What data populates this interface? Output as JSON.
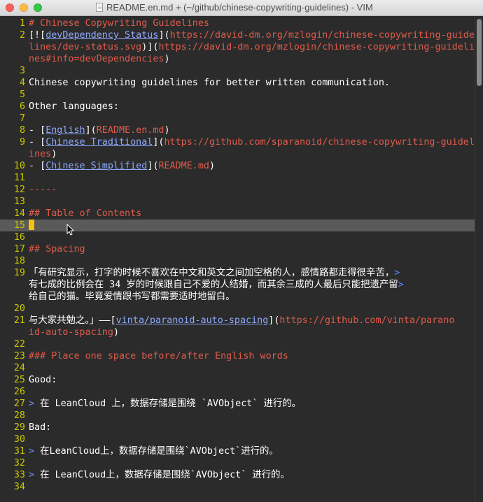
{
  "window": {
    "title": "README.en.md + (~/github/chinese-copywriting-guidelines) - VIM",
    "file_icon": "document-icon"
  },
  "colors": {
    "line_number": "#c9c900",
    "heading": "#e05a4b",
    "link_text": "#8ea9ff",
    "url": "#e05a4b",
    "quote_marker": "#6f8cff",
    "cursor": "#f4c20d",
    "cursorline": "#5a5a5a"
  },
  "lines": [
    {
      "n": "1",
      "segs": [
        [
          "# ",
          "h"
        ],
        [
          "Chinese Copywriting Guidelines",
          "h"
        ]
      ]
    },
    {
      "n": "2",
      "segs": [
        [
          "[![",
          ""
        ],
        [
          "devDependency Status",
          "lk"
        ],
        [
          "](",
          ""
        ],
        [
          "https://david-dm.org/mzlogin/chinese-copywriting-guide",
          "u"
        ]
      ]
    },
    {
      "n": "",
      "segs": [
        [
          "lines/dev-status.svg",
          "u"
        ],
        [
          ")](",
          ""
        ],
        [
          "https://david-dm.org/mzlogin/chinese-copywriting-guideli",
          "u"
        ]
      ]
    },
    {
      "n": "",
      "segs": [
        [
          "nes#info=devDependencies",
          "u"
        ],
        [
          ")",
          ""
        ]
      ]
    },
    {
      "n": "3",
      "segs": []
    },
    {
      "n": "4",
      "segs": [
        [
          "Chinese copywriting guidelines for better written communication.",
          ""
        ]
      ]
    },
    {
      "n": "5",
      "segs": []
    },
    {
      "n": "6",
      "segs": [
        [
          "Other languages:",
          ""
        ]
      ]
    },
    {
      "n": "7",
      "segs": []
    },
    {
      "n": "8",
      "segs": [
        [
          "- [",
          ""
        ],
        [
          "English",
          "lk"
        ],
        [
          "](",
          ""
        ],
        [
          "README.en.md",
          "u"
        ],
        [
          ")",
          ""
        ]
      ]
    },
    {
      "n": "9",
      "segs": [
        [
          "- [",
          ""
        ],
        [
          "Chinese Traditional",
          "lk"
        ],
        [
          "](",
          ""
        ],
        [
          "https://github.com/sparanoid/chinese-copywriting-guidel",
          "u"
        ]
      ]
    },
    {
      "n": "",
      "segs": [
        [
          "ines",
          "u"
        ],
        [
          ")",
          ""
        ]
      ]
    },
    {
      "n": "10",
      "segs": [
        [
          "- [",
          ""
        ],
        [
          "Chinese Simplified",
          "lk"
        ],
        [
          "](",
          ""
        ],
        [
          "README.md",
          "u"
        ],
        [
          ")",
          ""
        ]
      ]
    },
    {
      "n": "11",
      "segs": []
    },
    {
      "n": "12",
      "segs": [
        [
          "-----",
          "h"
        ]
      ]
    },
    {
      "n": "13",
      "segs": []
    },
    {
      "n": "14",
      "segs": [
        [
          "## ",
          "h"
        ],
        [
          "Table of Contents",
          "h"
        ]
      ]
    },
    {
      "n": "15",
      "segs": [],
      "cursor": true
    },
    {
      "n": "16",
      "segs": []
    },
    {
      "n": "17",
      "segs": [
        [
          "## ",
          "h"
        ],
        [
          "Spacing",
          "h"
        ]
      ]
    },
    {
      "n": "18",
      "segs": []
    },
    {
      "n": "19",
      "segs": [
        [
          "「有研究显示，打字的时候不喜欢在中文和英文之间加空格的人，感情路都走得很辛苦，",
          ""
        ],
        [
          ">",
          "ov"
        ]
      ]
    },
    {
      "n": "",
      "segs": [
        [
          "有七成的比例会在 34 岁的时候跟自己不爱的人结婚，而其余三成的人最后只能把遗产留",
          ""
        ],
        [
          ">",
          "ov"
        ]
      ]
    },
    {
      "n": "",
      "segs": [
        [
          "给自己的猫。毕竟爱情跟书写都需要适时地留白。",
          ""
        ]
      ]
    },
    {
      "n": "20",
      "segs": []
    },
    {
      "n": "21",
      "segs": [
        [
          "与大家共勉之。」——[",
          ""
        ],
        [
          "vinta/paranoid-auto-spacing",
          "lk"
        ],
        [
          "](",
          ""
        ],
        [
          "https://github.com/vinta/parano",
          "u"
        ]
      ]
    },
    {
      "n": "",
      "segs": [
        [
          "id-auto-spacing",
          "u"
        ],
        [
          ")",
          ""
        ]
      ]
    },
    {
      "n": "22",
      "segs": []
    },
    {
      "n": "23",
      "segs": [
        [
          "### ",
          "h"
        ],
        [
          "Place one space before/after English words",
          "h"
        ]
      ]
    },
    {
      "n": "24",
      "segs": []
    },
    {
      "n": "25",
      "segs": [
        [
          "Good:",
          ""
        ]
      ]
    },
    {
      "n": "26",
      "segs": []
    },
    {
      "n": "27",
      "segs": [
        [
          ">",
          "q"
        ],
        [
          " 在 LeanCloud 上，数据存储是围绕 `AVObject` 进行的。",
          ""
        ]
      ]
    },
    {
      "n": "28",
      "segs": []
    },
    {
      "n": "29",
      "segs": [
        [
          "Bad:",
          ""
        ]
      ]
    },
    {
      "n": "30",
      "segs": []
    },
    {
      "n": "31",
      "segs": [
        [
          ">",
          "q"
        ],
        [
          " 在LeanCloud上，数据存储是围绕`AVObject`进行的。",
          ""
        ]
      ]
    },
    {
      "n": "32",
      "segs": []
    },
    {
      "n": "33",
      "segs": [
        [
          ">",
          "q"
        ],
        [
          " 在 LeanCloud上，数据存储是围绕`AVObject` 进行的。",
          ""
        ]
      ]
    },
    {
      "n": "34",
      "segs": []
    }
  ]
}
